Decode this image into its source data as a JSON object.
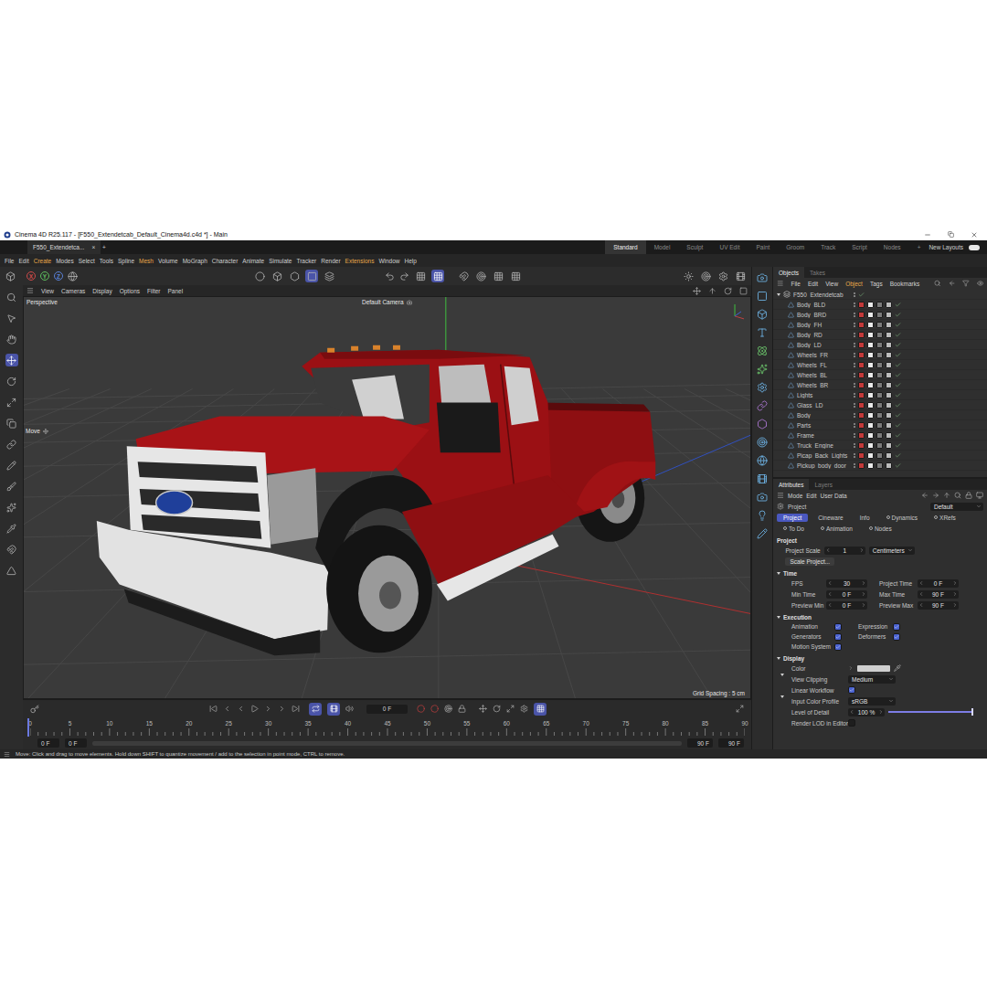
{
  "window": {
    "title": "Cinema 4D R25.117 - [F550_Extendetcab_Default_Cinema4d.c4d *] - Main"
  },
  "document_tab": {
    "label": "F550_Extendetca...",
    "close": "×",
    "add": "+"
  },
  "layouts": {
    "items": [
      {
        "label": "Standard",
        "selected": true
      },
      {
        "label": "Model",
        "selected": false
      },
      {
        "label": "Sculpt",
        "selected": false
      },
      {
        "label": "UV Edit",
        "selected": false
      },
      {
        "label": "Paint",
        "selected": false
      },
      {
        "label": "Groom",
        "selected": false
      },
      {
        "label": "Track",
        "selected": false
      },
      {
        "label": "Script",
        "selected": false
      },
      {
        "label": "Nodes",
        "selected": false
      }
    ],
    "add": "+",
    "new_layouts": "New Layouts"
  },
  "menu": [
    {
      "label": "File",
      "highlighted": false
    },
    {
      "label": "Edit",
      "highlighted": false
    },
    {
      "label": "Create",
      "highlighted": true
    },
    {
      "label": "Modes",
      "highlighted": false
    },
    {
      "label": "Select",
      "highlighted": false
    },
    {
      "label": "Tools",
      "highlighted": false
    },
    {
      "label": "Spline",
      "highlighted": false
    },
    {
      "label": "Mesh",
      "highlighted": true
    },
    {
      "label": "Volume",
      "highlighted": false
    },
    {
      "label": "MoGraph",
      "highlighted": false
    },
    {
      "label": "Character",
      "highlighted": false
    },
    {
      "label": "Animate",
      "highlighted": false
    },
    {
      "label": "Simulate",
      "highlighted": false
    },
    {
      "label": "Tracker",
      "highlighted": false
    },
    {
      "label": "Render",
      "highlighted": false
    },
    {
      "label": "Extensions",
      "highlighted": true
    },
    {
      "label": "Window",
      "highlighted": false
    },
    {
      "label": "Help",
      "highlighted": false
    }
  ],
  "toolbar": {
    "axes": [
      {
        "label": "X",
        "color": "#d04a4a"
      },
      {
        "label": "Y",
        "color": "#5fbf5f"
      },
      {
        "label": "Z",
        "color": "#5a82d8"
      }
    ]
  },
  "viewport": {
    "menu": [
      "View",
      "Cameras",
      "Display",
      "Options",
      "Filter",
      "Panel"
    ],
    "mode": "Perspective",
    "camera": "Default Camera",
    "grid_spacing": "Grid Spacing : 5 cm",
    "tool_hint": "Move"
  },
  "timeline": {
    "current_frame": "0 F",
    "ruler": [
      "0",
      "5",
      "10",
      "15",
      "20",
      "25",
      "30",
      "35",
      "40",
      "45",
      "50",
      "55",
      "60",
      "65",
      "70",
      "75",
      "80",
      "85",
      "90"
    ],
    "start_fields": [
      "0 F",
      "0 F"
    ],
    "end_fields": [
      "90 F",
      "90 F"
    ]
  },
  "objects": {
    "tabs": [
      {
        "label": "Objects",
        "selected": true
      },
      {
        "label": "Takes",
        "selected": false
      }
    ],
    "menu": [
      {
        "label": "File",
        "highlighted": false
      },
      {
        "label": "Edit",
        "highlighted": false
      },
      {
        "label": "View",
        "highlighted": false
      },
      {
        "label": "Object",
        "highlighted": true
      },
      {
        "label": "Tags",
        "highlighted": false
      },
      {
        "label": "Bookmarks",
        "highlighted": false
      }
    ],
    "root": {
      "label": "F550_Extendetcab",
      "expanded": true
    },
    "items": [
      {
        "label": "Body_BLD"
      },
      {
        "label": "Body_BRD"
      },
      {
        "label": "Body_FH"
      },
      {
        "label": "Body_RD"
      },
      {
        "label": "Body_LD"
      },
      {
        "label": "Wheels_FR"
      },
      {
        "label": "Wheels_FL"
      },
      {
        "label": "Wheels_BL"
      },
      {
        "label": "Wheels_BR"
      },
      {
        "label": "Lights"
      },
      {
        "label": "Glass_LD"
      },
      {
        "label": "Body"
      },
      {
        "label": "Parts"
      },
      {
        "label": "Frame"
      },
      {
        "label": "Truck_Engine"
      },
      {
        "label": "Picap_Back_Lights"
      },
      {
        "label": "Pickup_body_door"
      }
    ]
  },
  "attributes": {
    "tabs": [
      {
        "label": "Attributes",
        "selected": true
      },
      {
        "label": "Layers",
        "selected": false
      }
    ],
    "menu": [
      "Mode",
      "Edit",
      "User Data"
    ],
    "object": "Project",
    "preset": "Default",
    "tabs_row1": [
      {
        "label": "Project",
        "selected": true,
        "detached": false
      },
      {
        "label": "Cineware",
        "selected": false,
        "detached": false
      },
      {
        "label": "Info",
        "selected": false,
        "detached": false
      },
      {
        "label": "Dynamics",
        "selected": false,
        "detached": true
      },
      {
        "label": "XRefs",
        "selected": false,
        "detached": true
      }
    ],
    "tabs_row2": [
      {
        "label": "To Do",
        "selected": false,
        "detached": true
      },
      {
        "label": "Animation",
        "selected": false,
        "detached": true
      },
      {
        "label": "Nodes",
        "selected": false,
        "detached": true
      }
    ],
    "section": "Project",
    "project_scale": {
      "label": "Project Scale",
      "value": "1",
      "unit": "Centimeters"
    },
    "scale_button": "Scale Project...",
    "groups": [
      {
        "title": "Time",
        "expanded": true,
        "kind": "fields",
        "rows": [
          [
            {
              "label": "FPS",
              "value": "30"
            },
            {
              "label": "Project Time",
              "value": "0 F"
            }
          ],
          [
            {
              "label": "Min Time",
              "value": "0 F"
            },
            {
              "label": "Max Time",
              "value": "90 F"
            }
          ],
          [
            {
              "label": "Preview Min",
              "value": "0 F"
            },
            {
              "label": "Preview Max",
              "value": "90 F"
            }
          ]
        ]
      },
      {
        "title": "Execution",
        "expanded": true,
        "kind": "checks",
        "rows": [
          [
            {
              "label": "Animation",
              "checked": true
            },
            {
              "label": "Expression",
              "checked": true
            }
          ],
          [
            {
              "label": "Generators",
              "checked": true
            },
            {
              "label": "Deformers",
              "checked": true
            }
          ],
          [
            {
              "label": "Motion System",
              "checked": true
            }
          ]
        ]
      },
      {
        "title": "Display",
        "expanded": true,
        "kind": "display",
        "items": [
          {
            "kind": "color",
            "label": "Color",
            "color": "#cfcfcf"
          },
          {
            "kind": "dropdown",
            "label": "View Clipping",
            "value": "Medium",
            "expandable": true
          },
          {
            "kind": "check",
            "label": "Linear Workflow",
            "checked": true
          },
          {
            "kind": "dropdown",
            "label": "Input Color Profile",
            "value": "sRGB",
            "expandable": true
          },
          {
            "kind": "slider",
            "label": "Level of Detail",
            "value": "100 %",
            "level": 1
          },
          {
            "kind": "check",
            "label": "Render LOD in Editor",
            "checked": false
          }
        ]
      }
    ]
  },
  "status_bar": "Move: Click and drag to move elements. Hold down SHIFT to quantize movement / add to the selection in point mode, CTRL to remove."
}
